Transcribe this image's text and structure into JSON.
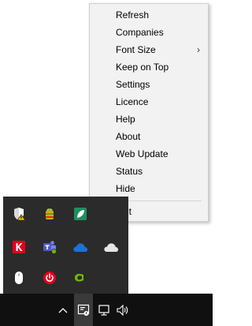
{
  "context_menu": {
    "items": [
      {
        "label": "Refresh"
      },
      {
        "label": "Companies"
      },
      {
        "label": "Font Size",
        "submenu_arrow": "›"
      },
      {
        "label": "Keep on Top"
      },
      {
        "label": "Settings"
      },
      {
        "label": "Licence"
      },
      {
        "label": "Help"
      },
      {
        "label": "About"
      },
      {
        "label": "Web Update"
      },
      {
        "label": "Status"
      },
      {
        "label": "Hide"
      },
      {
        "label": "Exit"
      }
    ]
  },
  "tray_overflow": {
    "icons": [
      "security-shield-warning-icon",
      "android-app-icon",
      "green-leaf-app-icon",
      "kaspersky-k-icon",
      "teams-icon",
      "onedrive-blue-cloud-icon",
      "onedrive-gray-cloud-icon",
      "mouse-icon",
      "power-app-icon",
      "nvidia-icon"
    ]
  },
  "taskbar": {
    "icons": [
      "chevron-up-icon",
      "app-tray-icon",
      "network-icon",
      "volume-icon"
    ]
  },
  "colors": {
    "menu_bg": "#f2f2f2",
    "tray_bg": "#2b2b2b",
    "taskbar_bg": "#101010",
    "highlight": "#cce8ff"
  }
}
